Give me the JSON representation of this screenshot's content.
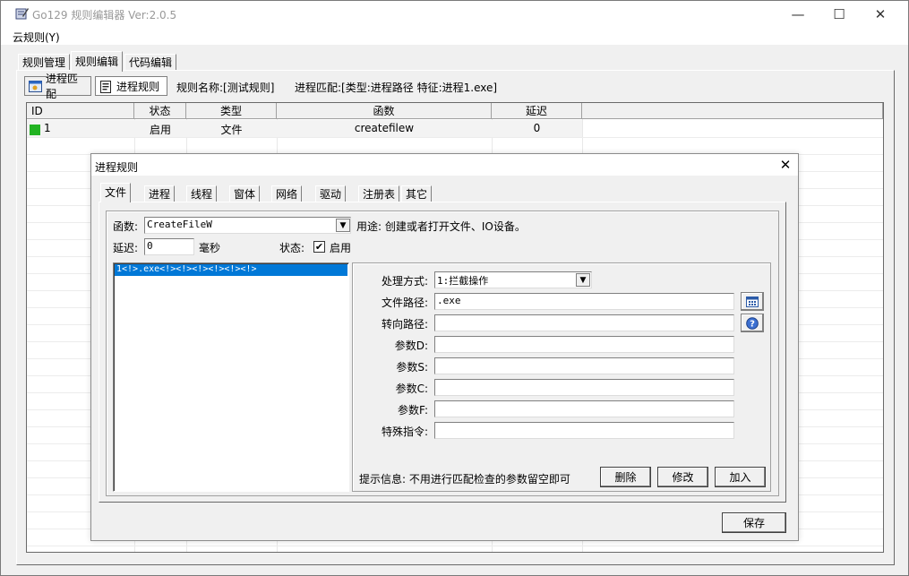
{
  "window": {
    "title": "Go129 规则编辑器  Ver:2.0.5",
    "minimize": "—",
    "maximize": "☐",
    "close": "✕"
  },
  "menu": {
    "cloud_rules": "云规则(Y)"
  },
  "tabs": [
    "规则管理",
    "规则编辑",
    "代码编辑"
  ],
  "toolbar": {
    "process_match": "进程匹配",
    "process_rules": "进程规则",
    "rule_name": "规则名称:[测试规则]",
    "match_info": "进程匹配:[类型:进程路径  特征:进程1.exe]"
  },
  "grid": {
    "columns": [
      "ID",
      "状态",
      "类型",
      "函数",
      "延迟"
    ],
    "rows": [
      {
        "id": "1",
        "status": "启用",
        "type": "文件",
        "func": "createfilew",
        "delay": "0",
        "status_color": "#22b322"
      }
    ]
  },
  "dialog": {
    "title": "进程规则",
    "close": "✕",
    "tabs": [
      "文件",
      "进程",
      "线程",
      "窗体",
      "网络",
      "驱动",
      "注册表",
      "其它"
    ],
    "function_label": "函数:",
    "function_value": "CreateFileW",
    "purpose": "用途: 创建或者打开文件、IO设备。",
    "delay_label": "延迟:",
    "delay_value": "0",
    "ms_label": "毫秒",
    "status_label": "状态:",
    "enabled_label": "启用",
    "enabled_checked": "✔",
    "list_items": [
      "1<!>.exe<!><!><!><!><!><!>"
    ],
    "fields": {
      "method_label": "处理方式:",
      "method_value": "1:拦截操作",
      "path_label": "文件路径:",
      "path_value": ".exe",
      "redirect_label": "转向路径:",
      "redirect_value": "",
      "paramD_label": "参数D:",
      "paramS_label": "参数S:",
      "paramC_label": "参数C:",
      "paramF_label": "参数F:",
      "special_label": "特殊指令:"
    },
    "hint": "提示信息: 不用进行匹配检查的参数留空即可",
    "delete": "删除",
    "modify": "修改",
    "add": "加入",
    "save": "保存"
  }
}
